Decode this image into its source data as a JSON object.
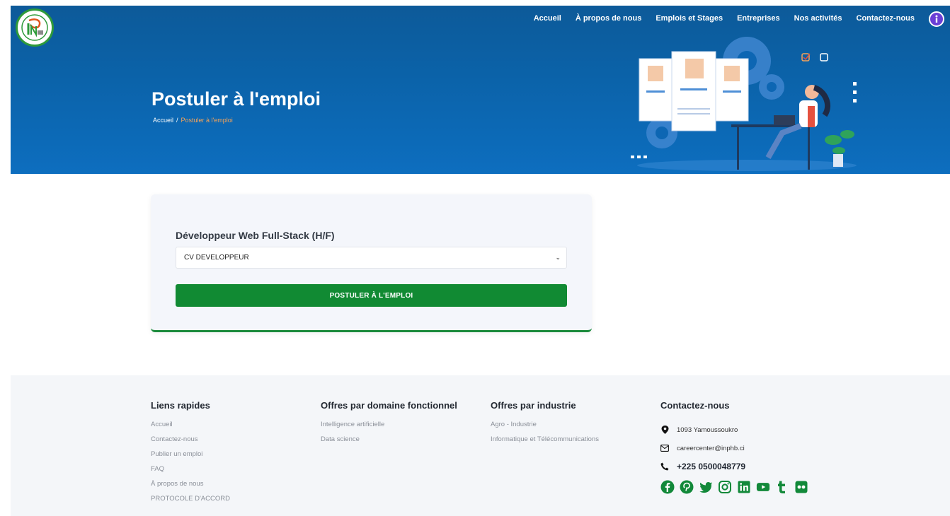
{
  "header": {
    "nav": [
      "Accueil",
      "À propos de nous",
      "Emplois et Stages",
      "Entreprises",
      "Nos activités",
      "Contactez-nous"
    ],
    "avatar_icon": "info-icon",
    "title": "Postuler à l'emploi",
    "breadcrumb": {
      "home": "Accueil",
      "separator": "/",
      "current": "Postuler à l'emploi"
    },
    "colors": {
      "hero": "#0b62a8",
      "breadcrumb_current": "#f4a35a"
    }
  },
  "application": {
    "job_title": "Développeur Web Full-Stack (H/F)",
    "cv_select_value": "CV DEVELOPPEUR",
    "apply_label": "POSTULER À L'EMPLOI",
    "accent": "#118a33"
  },
  "footer": {
    "quick_links": {
      "title": "Liens rapides",
      "items": [
        "Accueil",
        "Contactez-nous",
        "Publier un emploi",
        "FAQ",
        "À propos de nous",
        "PROTOCOLE D'ACCORD"
      ]
    },
    "functional_domain": {
      "title": "Offres par domaine fonctionnel",
      "items": [
        "Intelligence artificielle",
        "Data science"
      ]
    },
    "industry": {
      "title": "Offres par industrie",
      "items": [
        "Agro - Industrie",
        "Informatique et Télécommunications"
      ]
    },
    "contact": {
      "title": "Contactez-nous",
      "address": "1093 Yamoussoukro",
      "email": "careercenter@inphb.ci",
      "phone": "+225 0500048779",
      "socials": [
        "facebook-icon",
        "pinterest-icon",
        "twitter-icon",
        "instagram-icon",
        "linkedin-icon",
        "youtube-icon",
        "tumblr-icon",
        "flickr-icon"
      ]
    }
  }
}
